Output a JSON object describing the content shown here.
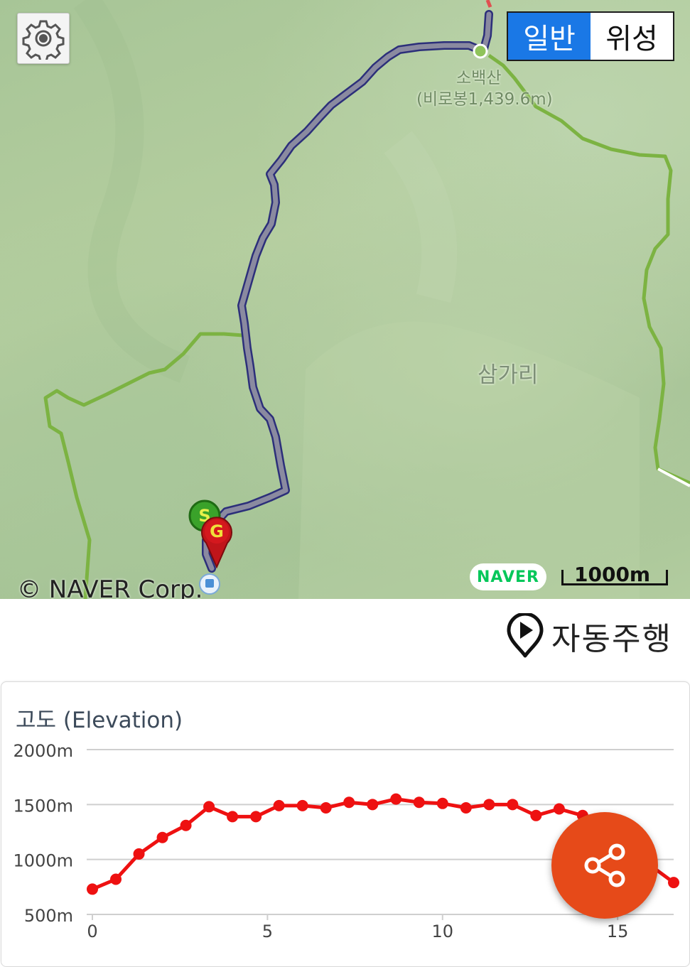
{
  "map": {
    "settings_icon": "gear-icon",
    "map_type": {
      "options": [
        "일반",
        "위성"
      ],
      "selected": "일반"
    },
    "labels": {
      "peak_name": "소백산",
      "peak_detail": "(비로봉1,439.6m)",
      "village": "삼가리"
    },
    "copyright": "© NAVER Corp.",
    "logo": "NAVER",
    "scale": "1000m",
    "markers": {
      "start": "S",
      "goal": "G"
    },
    "colors": {
      "route": "#4a4f9a",
      "trail": "#7cb342",
      "active_tab": "#1a78e6"
    }
  },
  "autoplay": {
    "icon": "play-pin-icon",
    "label": "자동주행"
  },
  "elevation": {
    "title": "고도 (Elevation)",
    "share_icon": "share-icon",
    "chart_data": {
      "type": "line",
      "title": "고도 (Elevation)",
      "xlabel": "",
      "ylabel": "",
      "xlim": [
        0,
        16.6
      ],
      "ylim": [
        500,
        2000
      ],
      "x_ticks": [
        "0",
        "5",
        "10",
        "15"
      ],
      "x_tick_values": [
        0,
        5,
        10,
        15
      ],
      "y_ticks": [
        "500m",
        "1000m",
        "1500m",
        "2000m"
      ],
      "y_tick_values": [
        500,
        1000,
        1500,
        2000
      ],
      "grid": true,
      "series": [
        {
          "color": "#ee1111",
          "x": [
            0,
            0.67,
            1.33,
            2.0,
            2.67,
            3.33,
            4.0,
            4.67,
            5.33,
            6.0,
            6.67,
            7.33,
            8.0,
            8.67,
            9.33,
            10.0,
            10.67,
            11.33,
            12.0,
            12.67,
            13.33,
            14.0,
            16.6
          ],
          "y": [
            730,
            820,
            1050,
            1200,
            1310,
            1480,
            1390,
            1390,
            1490,
            1490,
            1470,
            1520,
            1500,
            1550,
            1520,
            1510,
            1470,
            1500,
            1500,
            1400,
            1460,
            1400,
            790
          ]
        }
      ]
    }
  },
  "fab": {
    "icon": "share-icon"
  }
}
